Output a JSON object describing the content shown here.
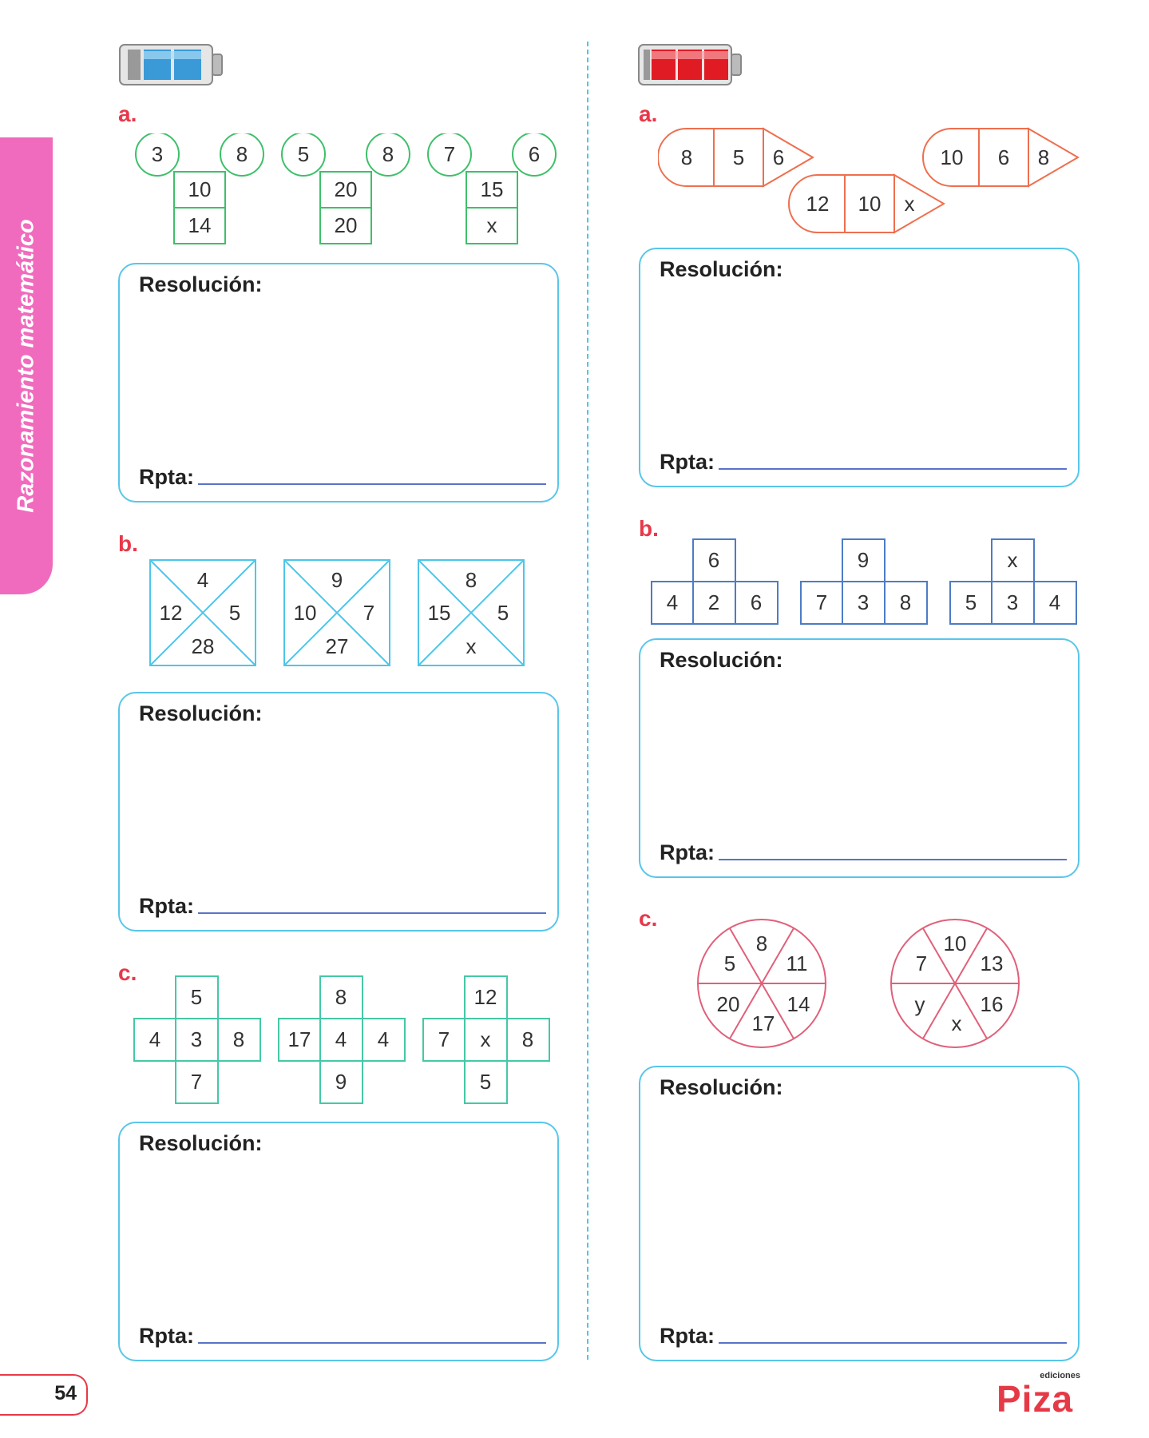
{
  "sidebar": {
    "title": "Razonamiento matemático"
  },
  "page": {
    "number": "54"
  },
  "brand": {
    "main": "Piza",
    "sub": "ediciones"
  },
  "common": {
    "resolucion": "Resolución:",
    "rpta": "Rpta:"
  },
  "colors": {
    "pink": "#f06bbd",
    "red_label": "#e8384a",
    "box_border": "#58c6ea",
    "line": "#5a73c7",
    "green": "#3fbf6a",
    "orange": "#ee6f4f",
    "blue": "#4d7cc4",
    "rose": "#e0607a",
    "cyan": "#4cc6ea"
  },
  "left": {
    "a": {
      "label": "a.",
      "figures": [
        {
          "top_left": "3",
          "top_right": "8",
          "middle": "10",
          "bottom": "14"
        },
        {
          "top_left": "5",
          "top_right": "8",
          "middle": "20",
          "bottom": "20"
        },
        {
          "top_left": "7",
          "top_right": "6",
          "middle": "15",
          "bottom": "x"
        }
      ]
    },
    "b": {
      "label": "b.",
      "figures": [
        {
          "top": "4",
          "left": "12",
          "right": "5",
          "bottom": "28"
        },
        {
          "top": "9",
          "left": "10",
          "right": "7",
          "bottom": "27"
        },
        {
          "top": "8",
          "left": "15",
          "right": "5",
          "bottom": "x"
        }
      ]
    },
    "c": {
      "label": "c.",
      "figures": [
        {
          "top": "5",
          "left": "4",
          "center": "3",
          "right": "8",
          "bottom": "7"
        },
        {
          "top": "8",
          "left": "17",
          "center": "4",
          "right": "4",
          "bottom": "9"
        },
        {
          "top": "12",
          "left": "7",
          "center": "x",
          "right": "8",
          "bottom": "5"
        }
      ]
    }
  },
  "right": {
    "a": {
      "label": "a.",
      "figures": [
        {
          "c1": "8",
          "c2": "5",
          "c3": "6"
        },
        {
          "c1": "12",
          "c2": "10",
          "c3": "x"
        },
        {
          "c1": "10",
          "c2": "6",
          "c3": "8"
        }
      ]
    },
    "b": {
      "label": "b.",
      "figures": [
        {
          "top": "6",
          "left": "4",
          "center": "2",
          "right": "6"
        },
        {
          "top": "9",
          "left": "7",
          "center": "3",
          "right": "8"
        },
        {
          "top": "x",
          "left": "5",
          "center": "3",
          "right": "4"
        }
      ]
    },
    "c": {
      "label": "c.",
      "figures": [
        {
          "top": "8",
          "upper_right": "11",
          "lower_right": "14",
          "bottom": "17",
          "lower_left": "20",
          "upper_left": "5"
        },
        {
          "top": "10",
          "upper_right": "13",
          "lower_right": "16",
          "bottom": "x",
          "lower_left": "y",
          "upper_left": "7"
        }
      ]
    }
  }
}
